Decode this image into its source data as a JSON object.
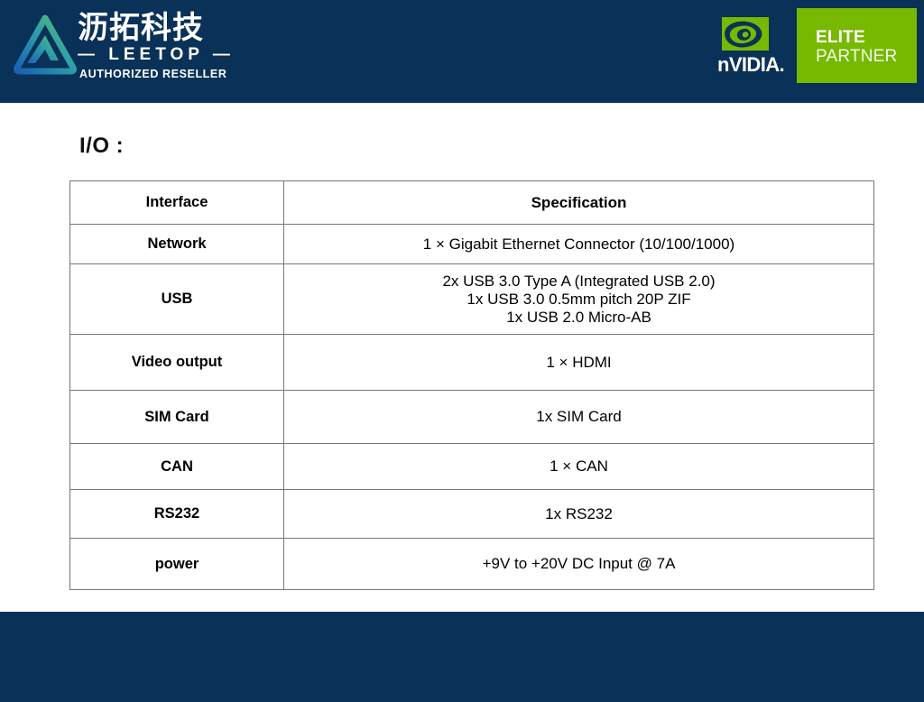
{
  "header": {
    "background_color": "#0a3157",
    "leetop": {
      "mark_name": "leetop-triangle-logo",
      "chinese_name": "沥拓科技",
      "latin_name": "— LEETOP —",
      "tagline": "AUTHORIZED RESELLER",
      "gradient_from": "#4fbf6f",
      "gradient_to": "#1c63b4"
    },
    "nvidia": {
      "wordmark": "nVIDIA.",
      "eye_color": "#76b900",
      "badge": {
        "background_color": "#76b900",
        "line1": "ELITE",
        "line2": "PARTNER"
      }
    }
  },
  "slide": {
    "title": "I/O :",
    "table": {
      "columns": [
        "Interface",
        "Specification"
      ],
      "rows": [
        {
          "interface": "Network",
          "spec_lines": [
            "1 × Gigabit Ethernet Connector (10/100/1000)"
          ]
        },
        {
          "interface": "USB",
          "spec_lines": [
            "2x USB 3.0 Type A (Integrated USB 2.0)",
            "1x USB 3.0 0.5mm pitch 20P ZIF",
            "1x USB 2.0 Micro-AB"
          ]
        },
        {
          "interface": "Video output",
          "spec_lines": [
            "1 × HDMI"
          ]
        },
        {
          "interface": "SIM Card",
          "spec_lines": [
            "1x SIM Card"
          ]
        },
        {
          "interface": "CAN",
          "spec_lines": [
            "1 × CAN"
          ]
        },
        {
          "interface": "RS232",
          "spec_lines": [
            "1x RS232"
          ]
        },
        {
          "interface": "power",
          "spec_lines": [
            "+9V to +20V DC Input @ 7A"
          ]
        }
      ],
      "border_color": "#777777"
    }
  },
  "footer": {
    "background_color": "#0a3157"
  }
}
